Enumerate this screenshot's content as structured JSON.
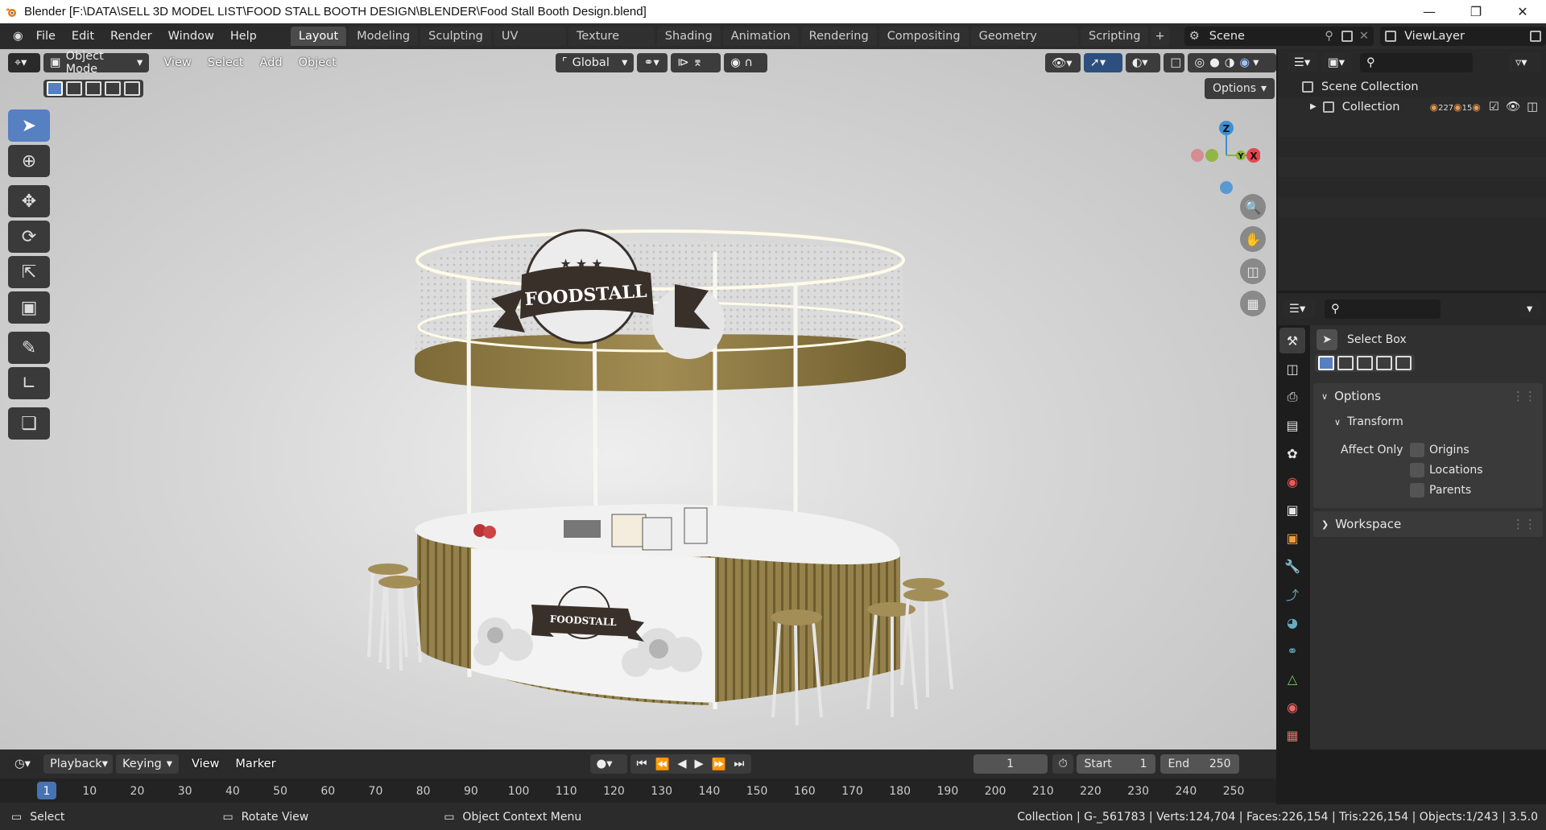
{
  "window": {
    "title": "Blender [F:\\DATA\\SELL 3D MODEL LIST\\FOOD STALL BOOTH DESIGN\\BLENDER\\Food Stall Booth Design.blend]"
  },
  "menu": [
    "File",
    "Edit",
    "Render",
    "Window",
    "Help"
  ],
  "workspaces": [
    "Layout",
    "Modeling",
    "Sculpting",
    "UV Editing",
    "Texture Paint",
    "Shading",
    "Animation",
    "Rendering",
    "Compositing",
    "Geometry Nodes",
    "Scripting"
  ],
  "add_tab": "+",
  "scene": {
    "name": "Scene",
    "view_layer": "ViewLayer"
  },
  "viewport": {
    "mode": "Object Mode",
    "menus": [
      "View",
      "Select",
      "Add",
      "Object"
    ],
    "transform_orientation": "Global",
    "options_label": "Options",
    "axes": {
      "x": "X",
      "y": "Y",
      "z": "Z"
    },
    "sign_top": "FOODSTALL",
    "sign_counter": "FOODSTALL"
  },
  "outliner": {
    "root": "Scene Collection",
    "collection": "Collection",
    "counts": "227",
    "counts2": "15"
  },
  "properties": {
    "tool_name": "Select Box",
    "options_label": "Options",
    "transform_label": "Transform",
    "affect_only_label": "Affect Only",
    "affect": [
      "Origins",
      "Locations",
      "Parents"
    ],
    "workspace_label": "Workspace"
  },
  "timeline": {
    "menus": [
      "Playback",
      "Keying",
      "View",
      "Marker"
    ],
    "current_frame": "1",
    "start_label": "Start",
    "start": "1",
    "end_label": "End",
    "end": "250",
    "ruler": [
      "1",
      "10",
      "20",
      "30",
      "40",
      "50",
      "60",
      "70",
      "80",
      "90",
      "100",
      "110",
      "120",
      "130",
      "140",
      "150",
      "160",
      "170",
      "180",
      "190",
      "200",
      "210",
      "220",
      "230",
      "240",
      "250"
    ]
  },
  "status": {
    "select": "Select",
    "rotate": "Rotate View",
    "context": "Object Context Menu",
    "stats": "Collection | G-_561783 | Verts:124,704 | Faces:226,154 | Tris:226,154 | Objects:1/243 | 3.5.0"
  },
  "colors": {
    "accent": "#5680c2",
    "gold": "#8e7c45",
    "axis_x": "#e8454e",
    "axis_y": "#8cb33a",
    "axis_z": "#3d8fd6"
  }
}
